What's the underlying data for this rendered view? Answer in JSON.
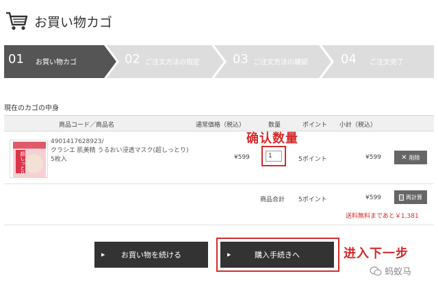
{
  "header": {
    "title": "お買い物カゴ",
    "icon": "cart-icon"
  },
  "steps": [
    {
      "num": "01",
      "label": "お買い物カゴ",
      "active": true
    },
    {
      "num": "02",
      "label": "ご注文方法の指定",
      "active": false
    },
    {
      "num": "03",
      "label": "ご注文方法の確認",
      "active": false
    },
    {
      "num": "04",
      "label": "ご注文完了",
      "active": false
    }
  ],
  "colors": {
    "step_active": "#555555",
    "step_inactive": "#dddddd",
    "accent_red": "#d42a2a",
    "button_dark": "#333333"
  },
  "section_title": "現在のカゴの中身",
  "table": {
    "headers": {
      "product": "商品コード／商品名",
      "price": "通常価格（税込）",
      "qty": "数量",
      "points": "ポイント",
      "subtotal": "小計（税込）"
    },
    "rows": [
      {
        "code": "4901417628923/",
        "name": "クラシエ 肌美精 うるおい浸透マスク(超しっとり) 5枚入",
        "price": "¥599",
        "qty": "1",
        "points": "5ポイント",
        "subtotal": "¥599",
        "delete_label": "削除",
        "image_text": "超しっとり"
      }
    ],
    "totals": {
      "label": "商品合計",
      "points": "5ポイント",
      "value": "¥599",
      "recalc_label": "再計算"
    },
    "shipping_note": "送料無料まであと￥1,381"
  },
  "buttons": {
    "continue": "お買い物を続ける",
    "checkout": "購入手続きへ"
  },
  "annotations": {
    "confirm_qty": "确认数量",
    "next_step": "进入下一步"
  },
  "watermark": "蚂蚁马"
}
